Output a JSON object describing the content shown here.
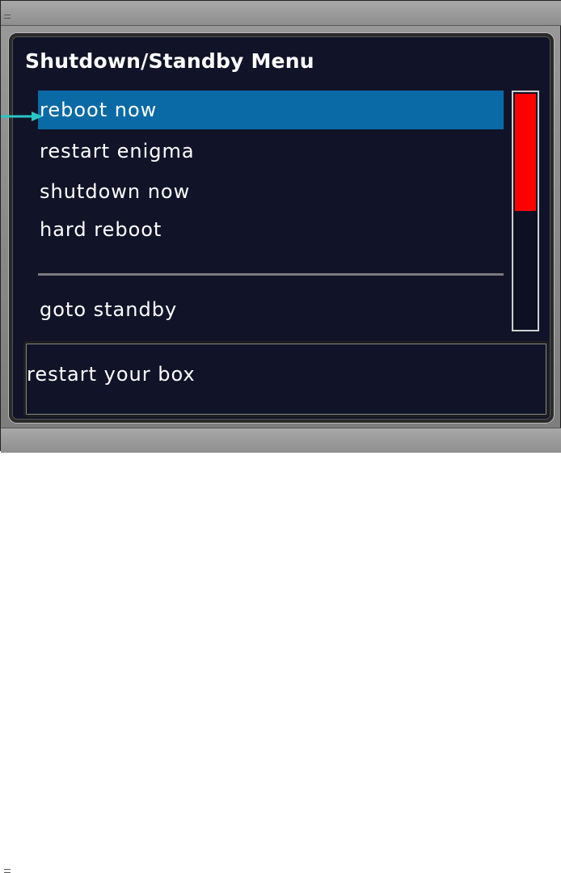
{
  "menu": {
    "title": "Shutdown/Standby Menu",
    "items": [
      {
        "label": "reboot now",
        "selected": true
      },
      {
        "label": "restart enigma",
        "selected": false
      },
      {
        "label": "shutdown now",
        "selected": false
      },
      {
        "label": "hard reboot",
        "selected": false
      },
      {
        "label": "goto standby",
        "selected": false
      }
    ]
  },
  "status": {
    "text": "restart your box"
  },
  "scrollbar": {
    "position_fraction": 0.5
  },
  "colors": {
    "background": "#111428",
    "selection": "#0a6aa6",
    "scroll_thumb": "#ff0000",
    "pointer": "#2ac6c6"
  },
  "icons": {
    "pointer": "arrow-right-icon"
  }
}
